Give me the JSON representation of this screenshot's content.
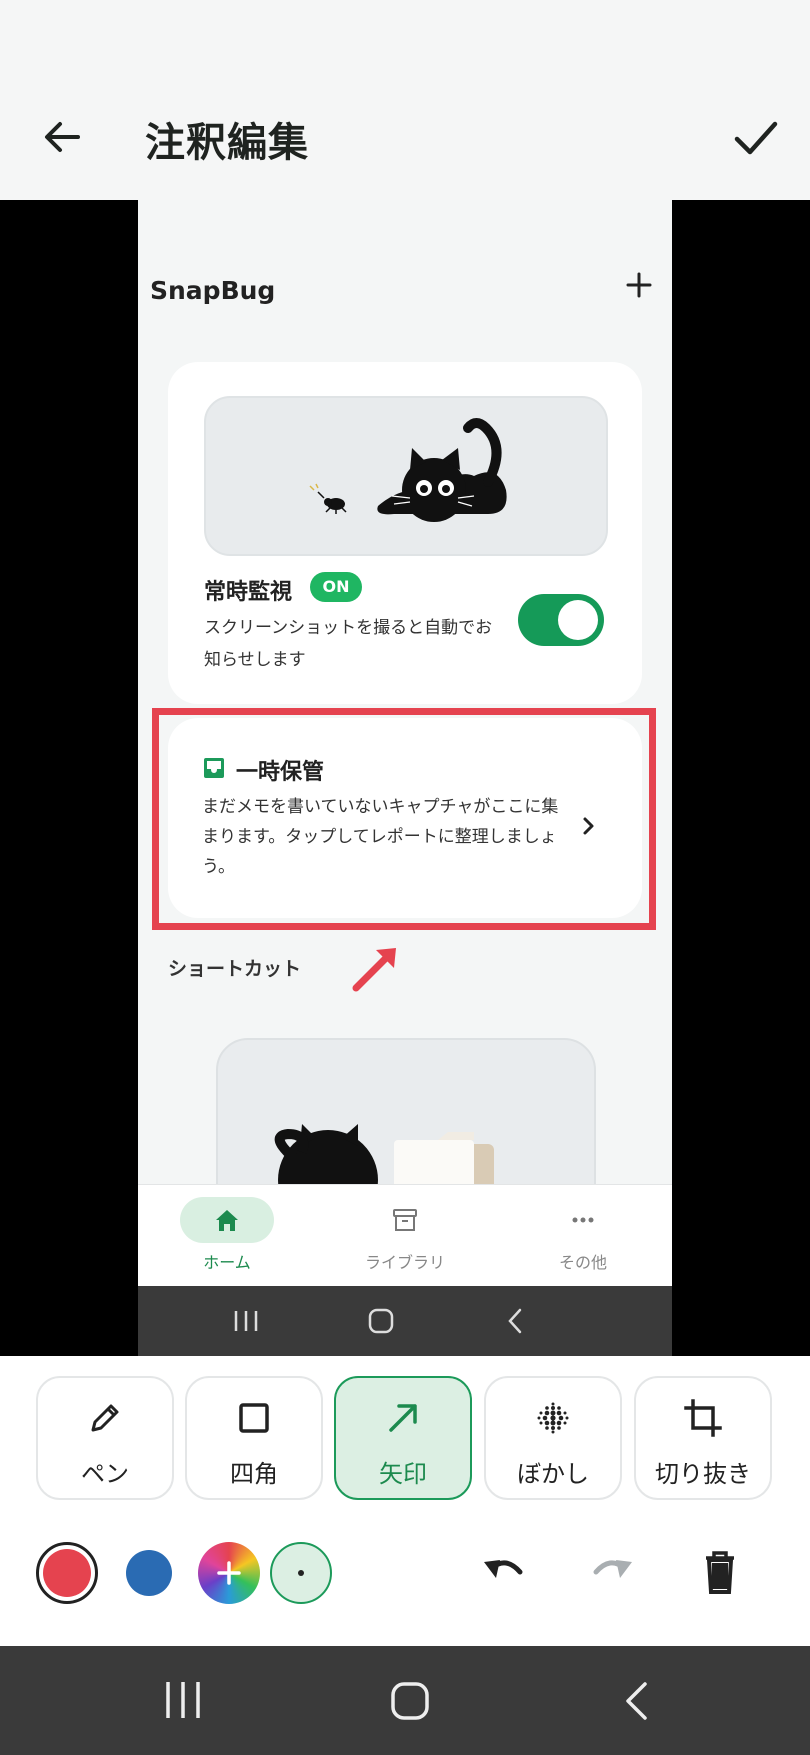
{
  "header": {
    "title": "注釈編集",
    "back_icon": "arrow-left-icon",
    "done_icon": "check-icon"
  },
  "screenshot": {
    "app_title": "SnapBug",
    "monitor_card": {
      "title": "常時監視",
      "badge": "ON",
      "description": "スクリーンショットを撮ると自動でお知らせします",
      "toggle_on": true
    },
    "temp_card": {
      "title": "一時保管",
      "description": "まだメモを書いていないキャプチャがここに集まります。タップしてレポートに整理しましょう。"
    },
    "shortcut_label": "ショートカット",
    "nav": [
      {
        "label": "ホーム",
        "icon": "home-icon",
        "active": true
      },
      {
        "label": "ライブラリ",
        "icon": "archive-icon",
        "active": false
      },
      {
        "label": "その他",
        "icon": "more-icon",
        "active": false
      }
    ]
  },
  "tools": [
    {
      "label": "ペン",
      "icon": "pencil-icon",
      "active": false
    },
    {
      "label": "四角",
      "icon": "square-icon",
      "active": false
    },
    {
      "label": "矢印",
      "icon": "arrow-icon",
      "active": true
    },
    {
      "label": "ぼかし",
      "icon": "blur-icon",
      "active": false
    },
    {
      "label": "切り抜き",
      "icon": "crop-icon",
      "active": false
    }
  ],
  "colors": {
    "accent": "#1c9a5a",
    "annotation_red": "#e5434f",
    "selected_color": "#e5434f",
    "palette": [
      "#e5434f",
      "#2a6bb3"
    ]
  }
}
